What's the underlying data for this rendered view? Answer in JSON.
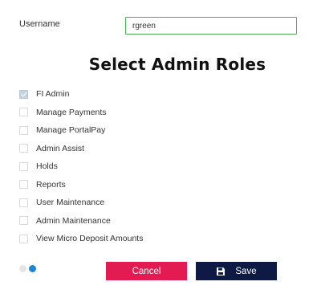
{
  "form": {
    "username_label": "Username",
    "username_value": "rgreen"
  },
  "title": "Select Admin Roles",
  "roles": [
    {
      "label": "FI Admin",
      "checked": true
    },
    {
      "label": "Manage Payments",
      "checked": false
    },
    {
      "label": "Manage PortalPay",
      "checked": false
    },
    {
      "label": "Admin Assist",
      "checked": false
    },
    {
      "label": "Holds",
      "checked": false
    },
    {
      "label": "Reports",
      "checked": false
    },
    {
      "label": "User Maintenance",
      "checked": false
    },
    {
      "label": "Admin Maintenance",
      "checked": false
    },
    {
      "label": "View Micro Deposit Amounts",
      "checked": false
    }
  ],
  "pager": {
    "pages": 2,
    "current": 2
  },
  "buttons": {
    "cancel_label": "Cancel",
    "save_label": "Save",
    "save_icon": "floppy-disk-icon"
  },
  "colors": {
    "input_border": "#4caf50",
    "cancel": "#e21b53",
    "save": "#0e1a43",
    "pager_active": "#1f86d6"
  }
}
